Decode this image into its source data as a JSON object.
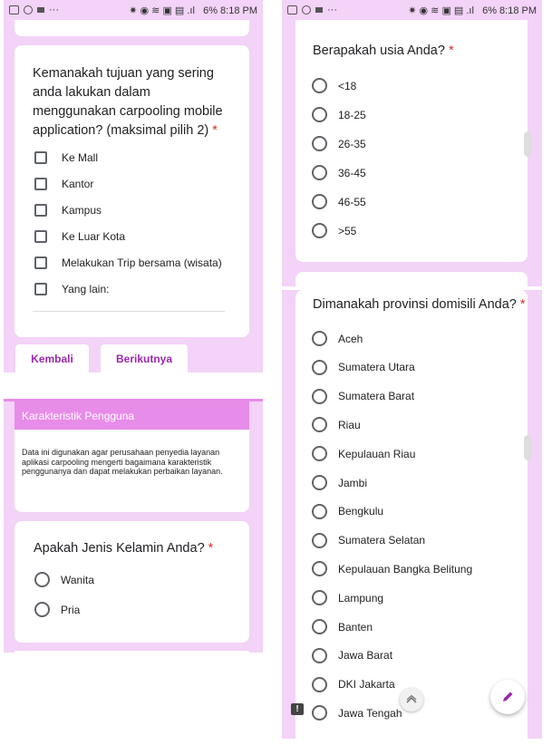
{
  "status_bar": {
    "text": "   6% 8:18 PM"
  },
  "status_icons": [
    "gallery-icon",
    "whatsapp-icon",
    "message-icon",
    "more-dots-icon"
  ],
  "panel_tl": {
    "question": "Kemanakah tujuan yang sering anda lakukan dalam menggunakan carpooling mobile application? (maksimal pilih 2)",
    "required_mark": "*",
    "options": [
      "Ke Mall",
      "Kantor",
      "Kampus",
      "Ke Luar Kota",
      "Melakukan Trip bersama (wisata)",
      "Yang lain:"
    ],
    "back_label": "Kembali",
    "next_label": "Berikutnya"
  },
  "panel_bl": {
    "section_title": "Karakteristik Pengguna",
    "section_desc": "Data ini digunakan agar perusahaan penyedia layanan aplikasi carpooling mengerti bagaimana karakteristik penggunanya dan dapat melakukan perbaikan layanan.",
    "question": "Apakah Jenis Kelamin Anda?",
    "required_mark": "*",
    "options": [
      "Wanita",
      "Pria"
    ]
  },
  "panel_tr": {
    "question": "Berapakah usia Anda?",
    "required_mark": "*",
    "options": [
      "<18",
      "18-25",
      "26-35",
      "36-45",
      "46-55",
      ">55"
    ]
  },
  "panel_br": {
    "question": "Dimanakah provinsi domisili Anda?",
    "required_mark": "*",
    "options": [
      "Aceh",
      "Sumatera Utara",
      "Sumatera Barat",
      "Riau",
      "Kepulauan Riau",
      "Jambi",
      "Bengkulu",
      "Sumatera Selatan",
      "Kepulauan Bangka Belitung",
      "Lampung",
      "Banten",
      "Jawa Barat",
      "DKI Jakarta",
      "Jawa Tengah"
    ]
  },
  "colors": {
    "accent": "#9c27b0",
    "panel_bg": "#f3d3f7",
    "header": "#e88ce9"
  }
}
